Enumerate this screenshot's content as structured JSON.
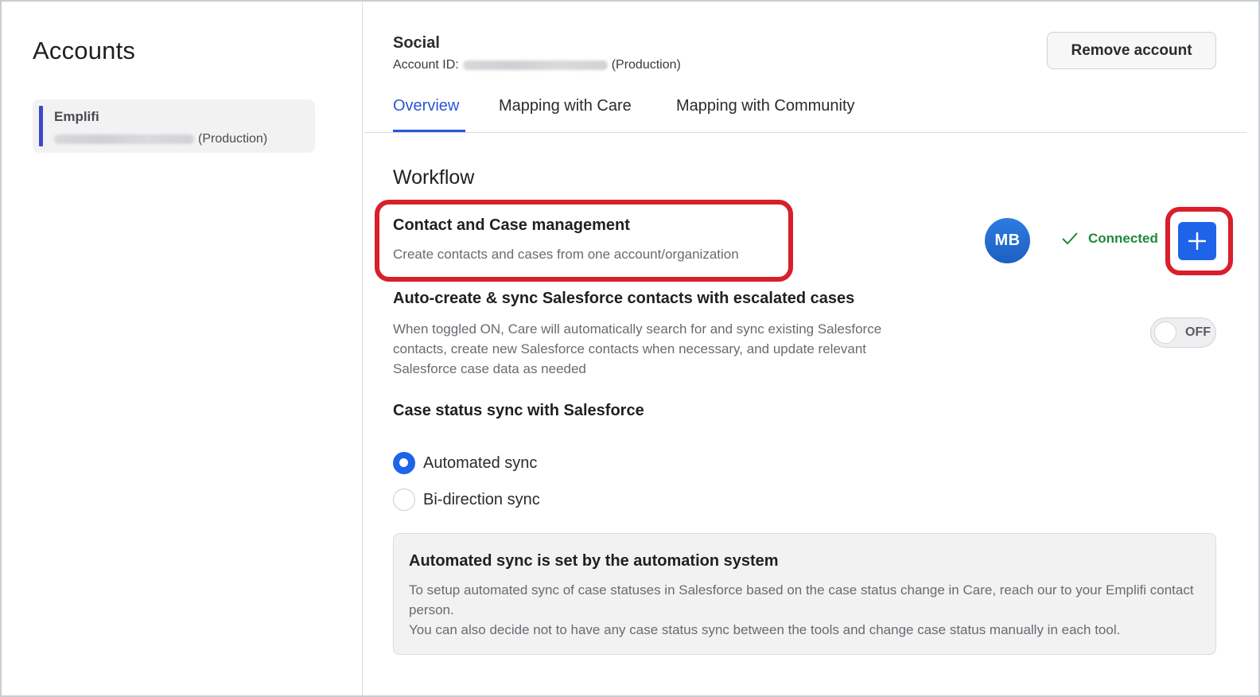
{
  "sidebar": {
    "title": "Accounts",
    "account": {
      "name": "Emplifi",
      "env": "(Production)"
    }
  },
  "header": {
    "title": "Social",
    "account_id_label": "Account ID:",
    "env": "(Production)",
    "remove_label": "Remove account"
  },
  "tabs": [
    {
      "label": "Overview",
      "active": true
    },
    {
      "label": "Mapping with Care",
      "active": false
    },
    {
      "label": "Mapping with Community",
      "active": false
    }
  ],
  "workflow": {
    "title": "Workflow",
    "contact_case": {
      "title": "Contact and Case management",
      "desc": "Create contacts and cases from one account/organization",
      "avatar": "MB",
      "status": "Connected",
      "add_icon": "plus-icon",
      "status_icon": "check-icon"
    },
    "auto_create": {
      "title": "Auto-create & sync Salesforce contacts with escalated cases",
      "desc": "When toggled ON, Care will automatically search for and sync existing Salesforce contacts, create new Salesforce contacts when necessary, and update relevant Salesforce case data as needed",
      "toggle_state": "OFF"
    },
    "case_sync": {
      "title": "Case status sync with Salesforce",
      "options": [
        {
          "label": "Automated sync",
          "checked": true
        },
        {
          "label": "Bi-direction sync",
          "checked": false
        }
      ]
    },
    "info": {
      "title": "Automated sync is set by the automation system",
      "line1": "To setup automated sync of case statuses in Salesforce based on the case status change in Care, reach our to your Emplifi contact person.",
      "line2": "You can also decide not to have any case status sync between the tools and change case status manually in each tool."
    }
  },
  "colors": {
    "accent": "#2c56d6",
    "primary_button": "#1f63e8",
    "success": "#1e8a3c",
    "highlight": "#d81f2b",
    "sidebar_bar": "#3c48c9"
  }
}
